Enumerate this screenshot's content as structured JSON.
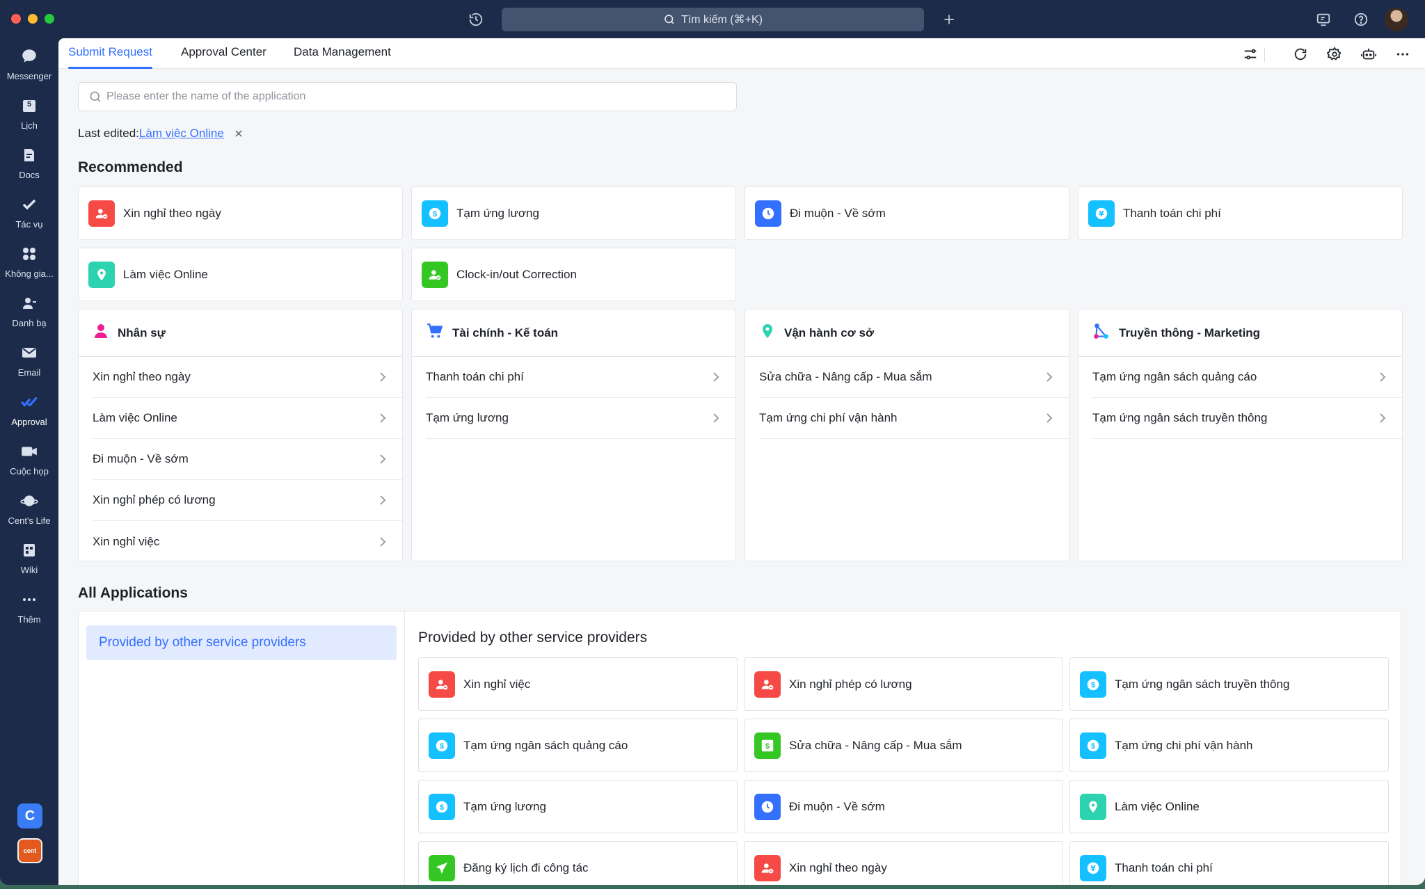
{
  "titlebar": {
    "search_label": "Tìm kiếm (⌘+K)",
    "icons": [
      "history-icon",
      "new-tab-icon",
      "screen-share-icon",
      "help-icon",
      "avatar"
    ]
  },
  "rail": {
    "items": [
      {
        "label": "Messenger",
        "icon": "chat-bubble-icon"
      },
      {
        "label": "Lịch",
        "icon": "calendar-icon",
        "badge": "5"
      },
      {
        "label": "Docs",
        "icon": "docs-icon"
      },
      {
        "label": "Tác vụ",
        "icon": "checkmark-icon"
      },
      {
        "label": "Không gia...",
        "icon": "apps-grid-icon"
      },
      {
        "label": "Danh bạ",
        "icon": "contacts-icon"
      },
      {
        "label": "Email",
        "icon": "email-icon"
      },
      {
        "label": "Approval",
        "icon": "approval-icon"
      },
      {
        "label": "Cuộc họp",
        "icon": "video-icon"
      },
      {
        "label": "Cent's Life",
        "icon": "planet-icon"
      },
      {
        "label": "Wiki",
        "icon": "wiki-icon"
      },
      {
        "label": "Thêm",
        "icon": "more-icon"
      }
    ],
    "bottom_c": "C",
    "bottom_cent": "cent"
  },
  "tabs": [
    "Submit Request",
    "Approval Center",
    "Data Management"
  ],
  "search": {
    "placeholder": "Please enter the name of the application"
  },
  "last_edited": {
    "label": "Last edited:",
    "link": "Làm việc Online"
  },
  "recommended": {
    "title": "Recommended",
    "items": [
      {
        "label": "Xin nghỉ theo ngày",
        "icon": "person-minus-icon",
        "color": "#f54a45"
      },
      {
        "label": "Tạm ứng lương",
        "icon": "dollar-icon",
        "color": "#14c0ff"
      },
      {
        "label": "Đi muộn - Về sớm",
        "icon": "clock-icon",
        "color": "#3370ff"
      },
      {
        "label": "Thanh toán chi phí",
        "icon": "yen-icon",
        "color": "#14c0ff"
      },
      {
        "label": "Làm việc Online",
        "icon": "location-icon",
        "color": "#2dd2b0"
      },
      {
        "label": "Clock-in/out Correction",
        "icon": "person-check-icon",
        "color": "#34c724"
      }
    ]
  },
  "categories": [
    {
      "title": "Nhân sự",
      "icon": "person-icon",
      "color": "#f01d94",
      "items": [
        "Xin nghỉ theo ngày",
        "Làm việc Online",
        "Đi muộn - Về sớm",
        "Xin nghỉ phép có lương",
        "Xin nghỉ việc"
      ]
    },
    {
      "title": "Tài chính - Kế toán",
      "icon": "cart-icon",
      "color": "#3370ff",
      "items": [
        "Thanh toán chi phí",
        "Tạm ứng lương"
      ]
    },
    {
      "title": "Vận hành cơ sở",
      "icon": "location-icon",
      "color": "#2dd2b0",
      "items": [
        "Sửa chữa - Nâng cấp - Mua sắm",
        "Tạm ứng chi phí vận hành"
      ]
    },
    {
      "title": "Truyền thông - Marketing",
      "icon": "share-nodes-icon",
      "color": "#3370ff",
      "items": [
        "Tạm ứng ngân sách quảng cáo",
        "Tạm ứng ngân sách truyền thông"
      ]
    }
  ],
  "all_apps": {
    "title": "All Applications",
    "provider": "Provided by other service providers",
    "section_title": "Provided by other service providers",
    "items": [
      {
        "label": "Xin nghỉ việc",
        "icon": "person-minus-icon",
        "color": "#f54a45"
      },
      {
        "label": "Xin nghỉ phép có lương",
        "icon": "person-minus-icon",
        "color": "#f54a45"
      },
      {
        "label": "Tạm ứng ngân sách truyền thông",
        "icon": "dollar-icon",
        "color": "#14c0ff"
      },
      {
        "label": "Tạm ứng ngân sách quảng cáo",
        "icon": "dollar-icon",
        "color": "#14c0ff"
      },
      {
        "label": "Sửa chữa - Nâng cấp - Mua sắm",
        "icon": "cash-icon",
        "color": "#34c724"
      },
      {
        "label": "Tạm ứng chi phí vận hành",
        "icon": "dollar-icon",
        "color": "#14c0ff"
      },
      {
        "label": "Tạm ứng lương",
        "icon": "dollar-icon",
        "color": "#14c0ff"
      },
      {
        "label": "Đi muộn - Về sớm",
        "icon": "clock-icon",
        "color": "#3370ff"
      },
      {
        "label": "Làm việc Online",
        "icon": "location-icon",
        "color": "#2dd2b0"
      },
      {
        "label": "Đăng ký lịch đi công tác",
        "icon": "plane-icon",
        "color": "#34c724"
      },
      {
        "label": "Xin nghỉ theo ngày",
        "icon": "person-minus-icon",
        "color": "#f54a45"
      },
      {
        "label": "Thanh toán chi phí",
        "icon": "yen-icon",
        "color": "#14c0ff"
      }
    ]
  },
  "colors": {
    "accent": "#3370ff",
    "rail": "#1c2b4a"
  }
}
